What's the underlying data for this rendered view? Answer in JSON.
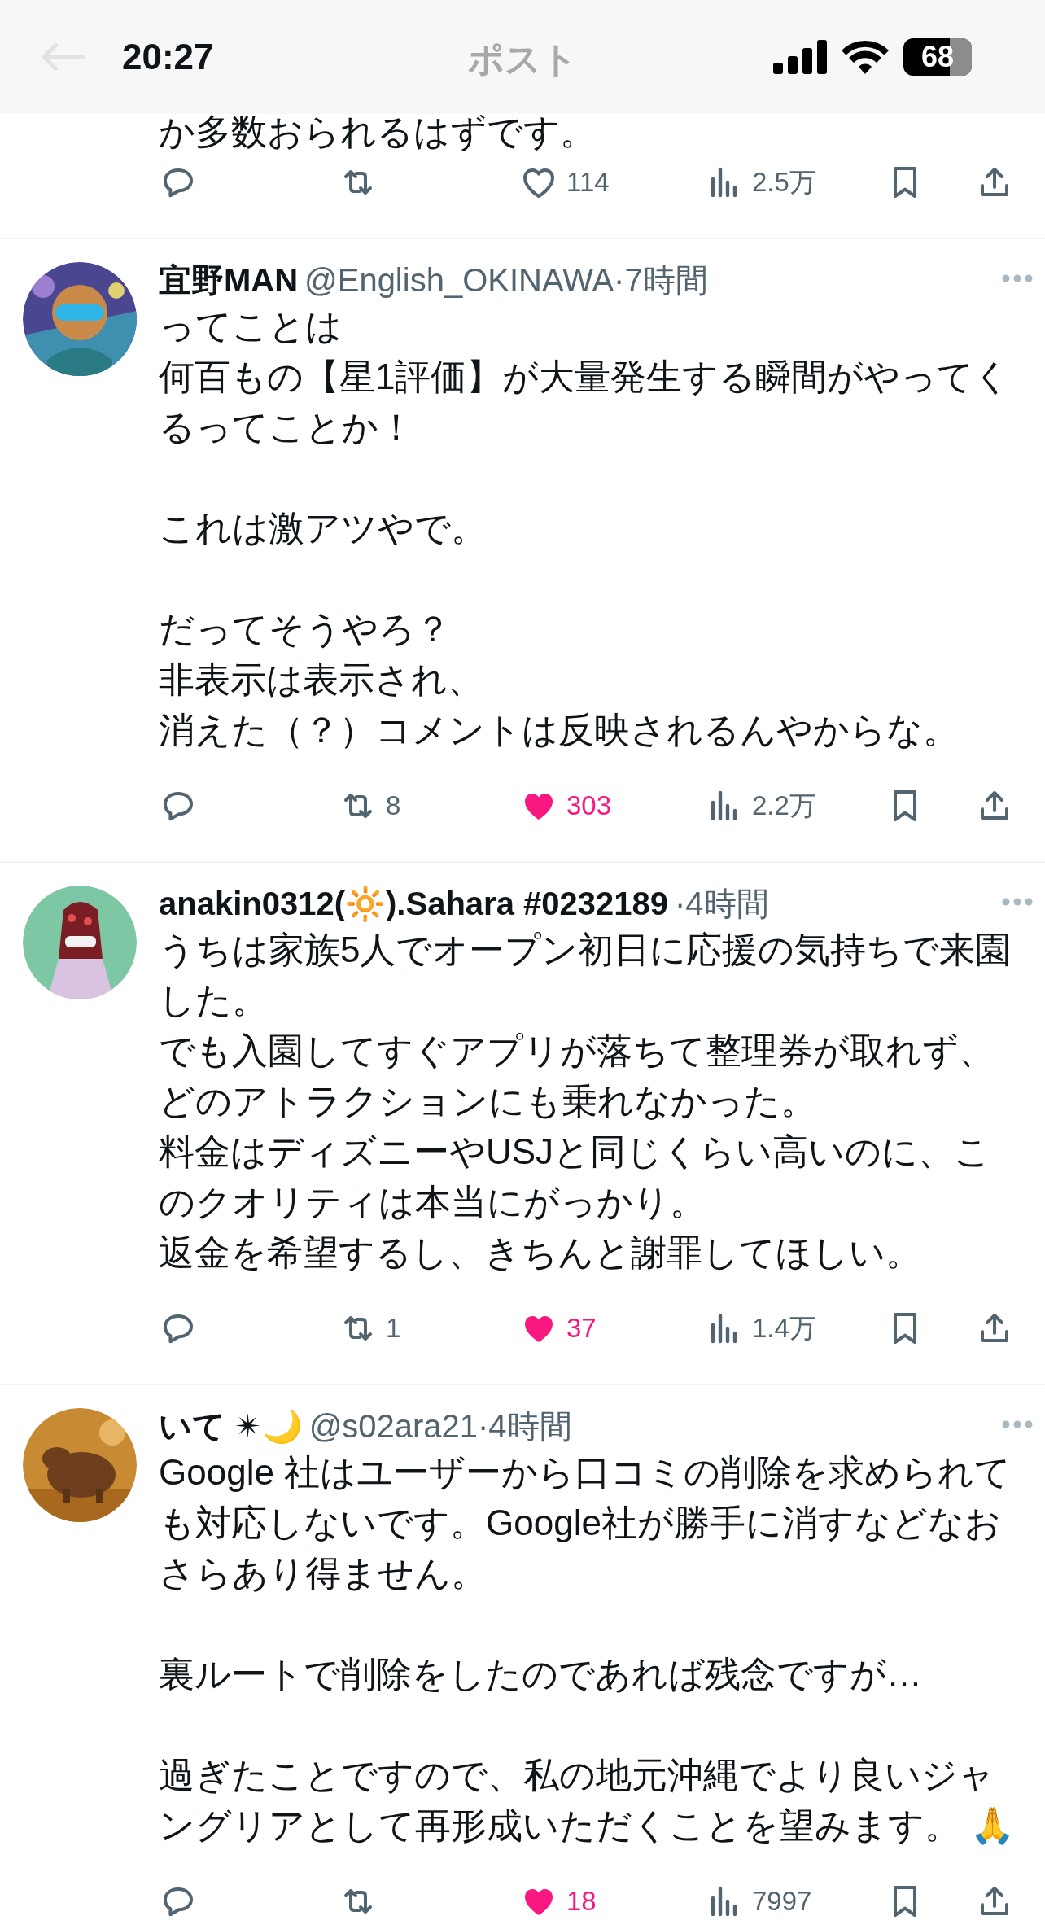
{
  "status_bar": {
    "time": "20:27",
    "battery": "68"
  },
  "header": {
    "title": "ポスト"
  },
  "posts": [
    {
      "kind": "partial",
      "paragraphs": [
        [
          "か多数おられるはずです。"
        ]
      ],
      "likes": "114",
      "liked": false,
      "views": "2.5万"
    },
    {
      "kind": "full",
      "name": "宜野MAN",
      "meta": "@English_OKINAWA·7時間",
      "paragraphs": [
        [
          "ってことは",
          "何百もの【星1評価】が大量発生する瞬間がやってくるってことか！"
        ],
        [
          "これは激アツやで。"
        ],
        [
          "だってそうやろ？",
          "非表示は表示され、",
          "消えた（？）コメントは反映されるんやからな。"
        ]
      ],
      "retweets": "8",
      "likes": "303",
      "liked": true,
      "views": "2.2万"
    },
    {
      "kind": "full",
      "name": "anakin0312(🔆).Sahara #0232189",
      "meta": "·4時間",
      "paragraphs": [
        [
          "うちは家族5人でオープン初日に応援の気持ちで来園した。",
          "でも入園してすぐアプリが落ちて整理券が取れず、",
          "どのアトラクションにも乗れなかった。",
          "料金はディズニーやUSJと同じくらい高いのに、このクオリティは本当にがっかり。",
          "返金を希望するし、きちんと謝罪してほしい。"
        ]
      ],
      "retweets": "1",
      "likes": "37",
      "liked": true,
      "views": "1.4万"
    },
    {
      "kind": "full",
      "name": "いて ✴🌙",
      "meta": "@s02ara21·4時間",
      "paragraphs": [
        [
          "Google 社はユーザーから口コミの削除を求められても対応しないです。Google社が勝手に消すなどなおさらあり得ません。"
        ],
        [
          "裏ルートで削除をしたのであれば残念ですが…"
        ],
        [
          "過ぎたことですので、私の地元沖縄でより良いジャングリアとして再形成いただくことを望みます。 🙏"
        ]
      ],
      "likes": "18",
      "liked": true,
      "views": "7997"
    }
  ]
}
